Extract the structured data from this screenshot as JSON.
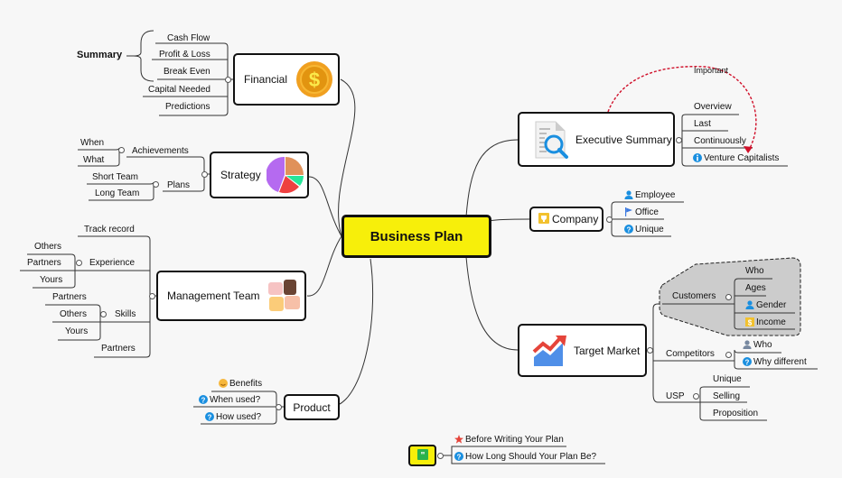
{
  "central": {
    "label": "Business Plan"
  },
  "financial": {
    "label": "Financial",
    "icon": "dollar-coin-icon",
    "summary_label": "Summary",
    "children": [
      "Cash Flow",
      "Profit & Loss",
      "Break Even",
      "Capital Needed",
      "Predictions"
    ]
  },
  "strategy": {
    "label": "Strategy",
    "icon": "pie-chart-icon",
    "achievements": {
      "label": "Achievements",
      "children": [
        "When",
        "What"
      ]
    },
    "plans": {
      "label": "Plans",
      "children": [
        "Short Team",
        "Long Team"
      ]
    }
  },
  "management": {
    "label": "Management Team",
    "icon": "team-hands-icon",
    "track_record": "Track record",
    "experience": {
      "label": "Experience",
      "children": [
        "Others",
        "Partners",
        "Yours"
      ]
    },
    "skills": {
      "label": "Skills",
      "children": [
        "Partners",
        "Others",
        "Yours"
      ]
    },
    "partners": "Partners"
  },
  "product": {
    "label": "Product",
    "children": [
      {
        "label": "Benefits",
        "icon": "smiley-icon"
      },
      {
        "label": "When used?",
        "icon": "question-icon"
      },
      {
        "label": "How used?",
        "icon": "question-icon"
      }
    ]
  },
  "executive": {
    "label": "Executive Summary",
    "icon": "document-search-icon",
    "relationship_label": "Important",
    "children": [
      {
        "label": "Overview"
      },
      {
        "label": "Last"
      },
      {
        "label": "Continuously"
      },
      {
        "label": "Venture Capitalists",
        "icon": "info-icon"
      }
    ]
  },
  "company": {
    "label": "Company",
    "icon": "trophy-icon",
    "children": [
      {
        "label": "Employee",
        "icon": "person-icon"
      },
      {
        "label": "Office",
        "icon": "flag-icon"
      },
      {
        "label": "Unique",
        "icon": "question-icon"
      }
    ]
  },
  "target": {
    "label": "Target Market",
    "icon": "trend-chart-icon",
    "customers": {
      "label": "Customers",
      "children": [
        {
          "label": "Who"
        },
        {
          "label": "Ages"
        },
        {
          "label": "Gender",
          "icon": "person-icon"
        },
        {
          "label": "Income",
          "icon": "dollar-icon"
        }
      ]
    },
    "competitors": {
      "label": "Competitors",
      "children": [
        {
          "label": "Who",
          "icon": "person-icon"
        },
        {
          "label": "Why different",
          "icon": "question-icon"
        }
      ]
    },
    "usp": {
      "label": "USP",
      "children": [
        "Unique",
        "Selling",
        "Proposition"
      ]
    }
  },
  "notes": {
    "icon": "quote-icon",
    "children": [
      {
        "label": "Before Writing Your Plan",
        "icon": "star-icon"
      },
      {
        "label": "How Long Should Your Plan Be?",
        "icon": "question-icon"
      }
    ]
  },
  "colors": {
    "central": "#f7ef0a",
    "relationship": "#d0102a",
    "boundary": "#cccccc"
  }
}
